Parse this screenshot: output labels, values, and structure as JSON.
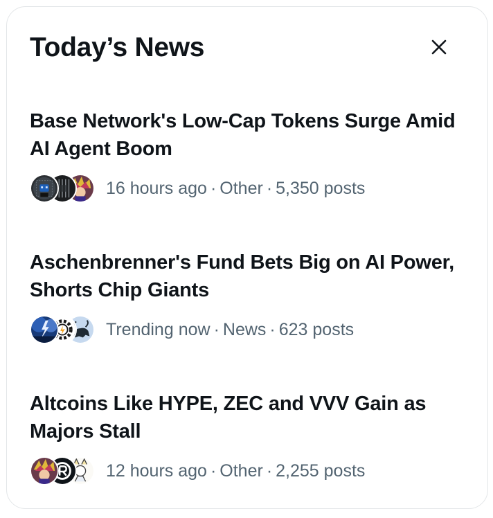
{
  "panel": {
    "title": "Today’s News",
    "close_icon": "close-icon"
  },
  "news": [
    {
      "headline": "Base Network's Low-Cap Tokens Surge Amid AI Agent Boom",
      "time": "16 hours ago",
      "category": "Other",
      "posts": "5,350 posts",
      "avatars": [
        "dark-robot-avatar",
        "striped-robot-avatar",
        "anime-character-avatar"
      ]
    },
    {
      "headline": "Aschenbrenner's Fund Bets Big on AI Power, Shorts Chip Giants",
      "time": "Trending now",
      "category": "News",
      "posts": "623 posts",
      "avatars": [
        "lightning-storm-avatar",
        "gear-logo-avatar",
        "bull-avatar"
      ]
    },
    {
      "headline": "Altcoins Like HYPE, ZEC and VVV Gain as Majors Stall",
      "time": "12 hours ago",
      "category": "Other",
      "posts": "2,255 posts",
      "avatars": [
        "anime-character-avatar",
        "r-logo-avatar",
        "sketch-character-avatar"
      ]
    }
  ],
  "separator": "·"
}
